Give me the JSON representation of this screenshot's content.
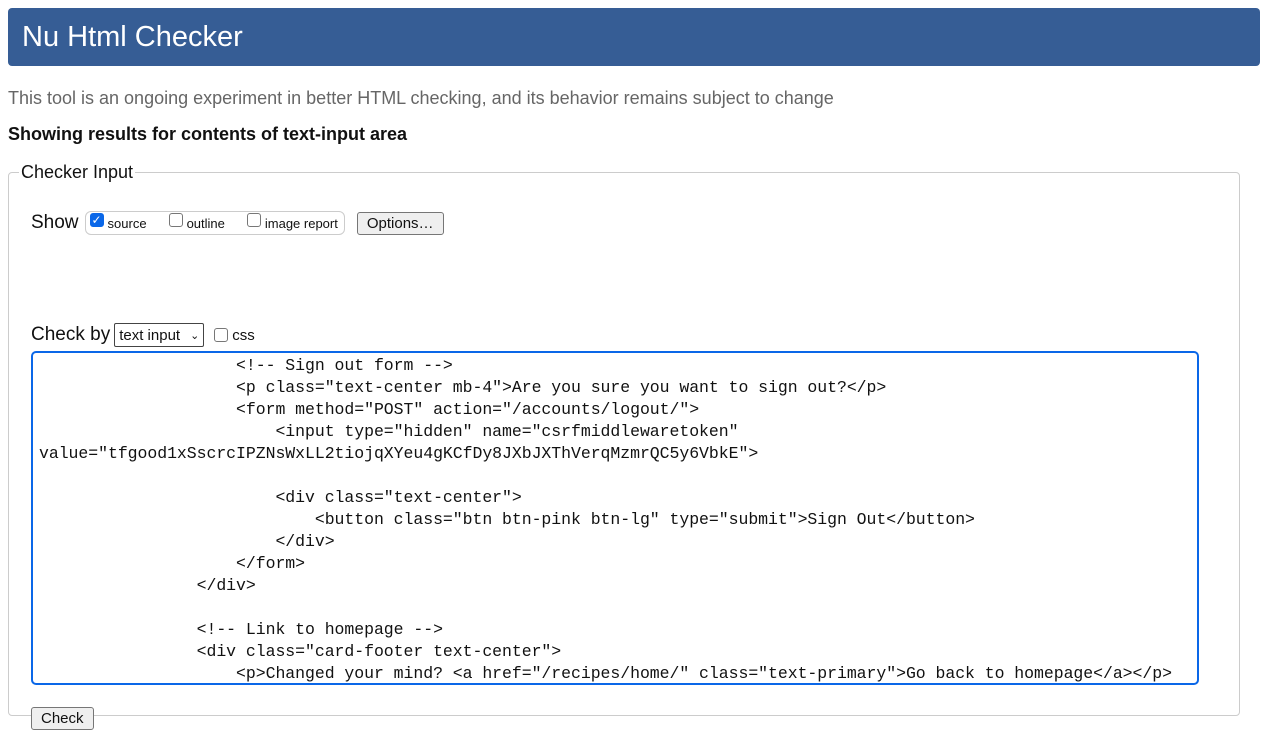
{
  "header": {
    "title": "Nu Html Checker"
  },
  "intro": "This tool is an ongoing experiment in better HTML checking, and its behavior remains subject to change",
  "showing": "Showing results for contents of text-input area",
  "form": {
    "legend": "Checker Input",
    "show_label": "Show",
    "show_options": [
      {
        "label": "source",
        "checked": true
      },
      {
        "label": "outline",
        "checked": false
      },
      {
        "label": "image report",
        "checked": false
      }
    ],
    "options_button": "Options…",
    "check_by_label": "Check by",
    "check_by_value": "text input",
    "css_label": "css",
    "check_button": "Check",
    "source_lines": [
      "                    <!-- Sign out form -->",
      "                    <p class=\"text-center mb-4\">Are you sure you want to sign out?</p>",
      "                    <form method=\"POST\" action=\"/accounts/logout/\">",
      "                        <input type=\"hidden\" name=\"csrfmiddlewaretoken\"",
      "value=\"tfgood1xSscrcIPZNsWxLL2tiojqXYeu4gKCfDy8JXbJXThVerqMzmrQC5y6VbkE\">",
      "",
      "                        <div class=\"text-center\">",
      "                            <button class=\"btn btn-pink btn-lg\" type=\"submit\">Sign Out</button>",
      "                        </div>",
      "                    </form>",
      "                </div>",
      "",
      "                <!-- Link to homepage -->",
      "                <div class=\"card-footer text-center\">",
      "                    <p>Changed your mind? <a href=\"/recipes/home/\" class=\"text-primary\">Go back to homepage</a></p>"
    ]
  }
}
